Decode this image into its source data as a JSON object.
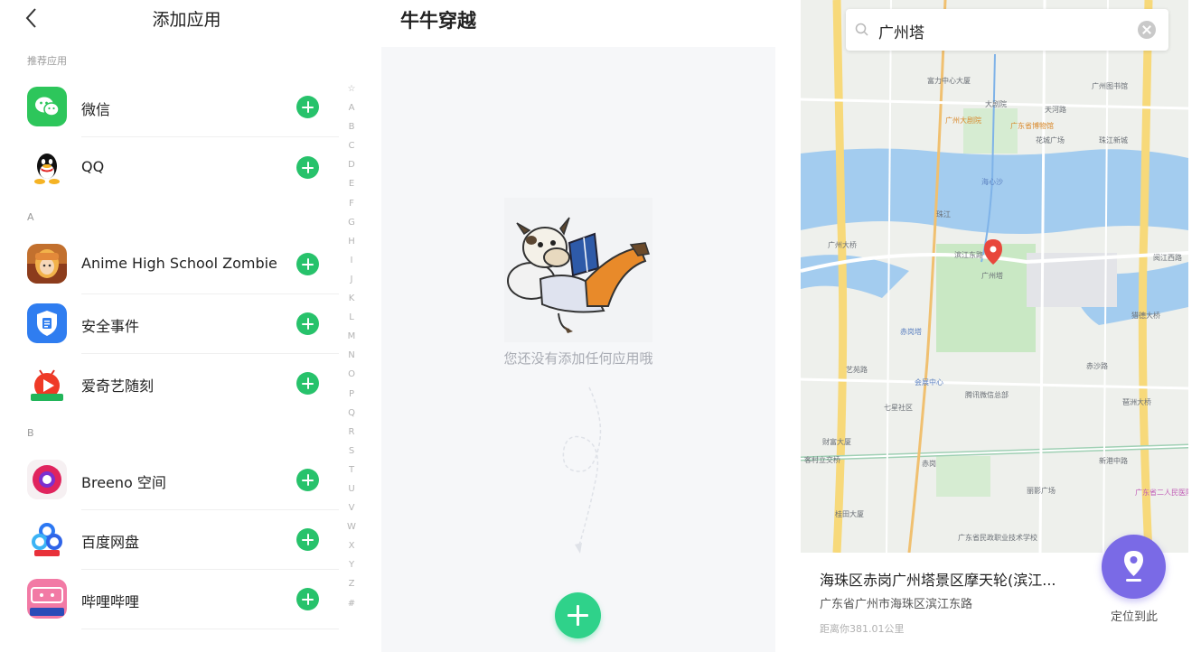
{
  "panel1": {
    "title": "添加应用",
    "sections": [
      "推荐应用",
      "A",
      "B"
    ],
    "apps": [
      {
        "name": "微信",
        "icon": "wechat-icon"
      },
      {
        "name": "QQ",
        "icon": "qq-icon"
      },
      {
        "name": "Anime High School Zombie",
        "icon": "anime-game-icon"
      },
      {
        "name": "安全事件",
        "icon": "security-event-icon"
      },
      {
        "name": "爱奇艺随刻",
        "icon": "iqiyi-suike-icon"
      },
      {
        "name": "Breeno 空间",
        "icon": "breeno-icon"
      },
      {
        "name": "百度网盘",
        "icon": "baidu-netdisk-icon"
      },
      {
        "name": "哔哩哔哩",
        "icon": "bilibili-icon"
      }
    ],
    "index_letters": [
      "☆",
      "A",
      "B",
      "C",
      "D",
      "E",
      "F",
      "G",
      "H",
      "I",
      "J",
      "K",
      "L",
      "M",
      "N",
      "O",
      "P",
      "Q",
      "R",
      "S",
      "T",
      "U",
      "V",
      "W",
      "X",
      "Y",
      "Z",
      "#"
    ],
    "colors": {
      "add_button": "#27c26b"
    }
  },
  "panel2": {
    "title": "牛牛穿越",
    "empty_text": "您还没有添加任何应用哦",
    "colors": {
      "fab": "#2fd28a"
    }
  },
  "panel3": {
    "search_query": "广州塔",
    "place_name": "海珠区赤岗广州塔景区摩天轮(滨江...",
    "place_address": "广东省广州市海珠区滨江东路",
    "distance": "距离你381.01公里",
    "locate_label": "定位到此",
    "map_labels": [
      "广州塔",
      "海心沙",
      "广州大剧院",
      "广东省博物馆",
      "花城广场",
      "珠江",
      "滨江东路",
      "新港中路",
      "广州大桥",
      "艺苑路",
      "阅江西路",
      "大剧院",
      "赤岗塔",
      "广州图书馆",
      "富力中心大厦",
      "天河路",
      "珠江新城",
      "会展中心",
      "客村立交桥",
      "赤岗",
      "财富大厦",
      "丽影广场",
      "广东省二人民医院",
      "广东省民政职业技术学校",
      "桂田大厦",
      "七星社区",
      "腾讯微信总部",
      "琶洲大桥",
      "猎德大桥",
      "赤沙路"
    ],
    "colors": {
      "locate_button": "#7a6ae6",
      "river": "#a3ccef",
      "park": "#c9e8c4",
      "road": "#f7d97a"
    }
  }
}
